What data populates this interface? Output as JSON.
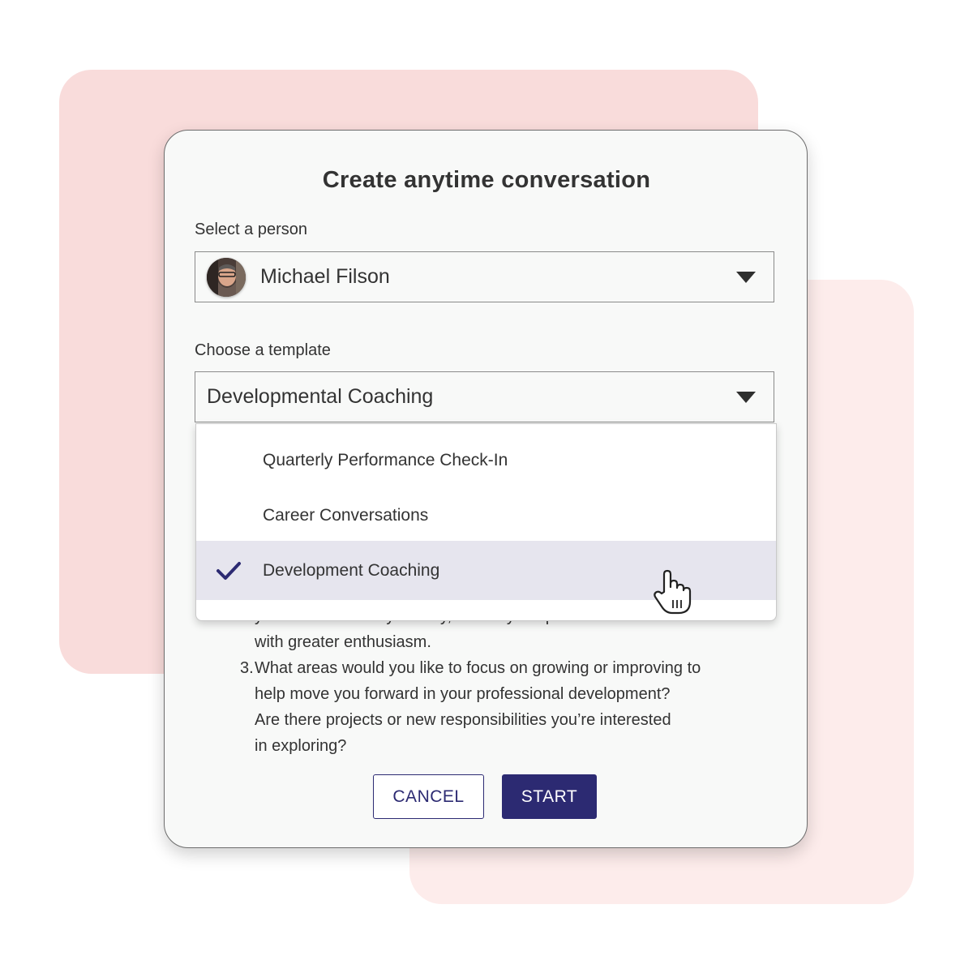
{
  "dialog": {
    "title": "Create anytime conversation",
    "person": {
      "label": "Select a person",
      "value": "Michael Filson"
    },
    "template": {
      "label": "Choose a template",
      "value": "Developmental Coaching",
      "options": [
        {
          "label": "Quarterly Performance Check-In",
          "selected": false
        },
        {
          "label": "Career Conversations",
          "selected": false
        },
        {
          "label": "Development Coaching",
          "selected": true
        }
      ]
    },
    "body": {
      "partial_line": "you excited about your day, or that you speak about",
      "line_enthusiasm": "with greater enthusiasm.",
      "q3_number": "3.",
      "q3_lines": [
        "What areas would you like to focus on growing or improving to",
        "help move you forward in your professional development?",
        "Are there projects or new responsibilities you’re interested",
        "in exploring?"
      ]
    },
    "buttons": {
      "cancel": "CANCEL",
      "start": "START"
    }
  },
  "colors": {
    "accent": "#2c2a72",
    "selected_row": "#e6e5ee",
    "backdrop_pink": "#f9dcdb",
    "backdrop_light_pink": "#fdeceb"
  },
  "icons": {
    "dropdown": "caret-down-icon",
    "check": "checkmark-icon",
    "cursor": "hand-pointer-icon"
  }
}
